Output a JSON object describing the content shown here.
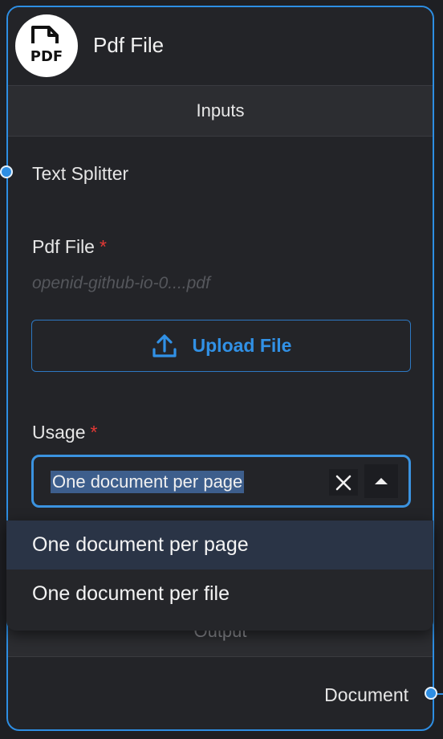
{
  "node": {
    "title": "Pdf File",
    "icon": "pdf-file-icon",
    "icon_text": "PDF",
    "accent_color": "#2d8ee3"
  },
  "inputs": {
    "section_label": "Inputs",
    "connection_label": "Text Splitter",
    "pdf_file": {
      "label": "Pdf File",
      "required_mark": "*",
      "filename": "openid-github-io-0....pdf",
      "upload_label": "Upload File",
      "upload_icon": "upload-icon"
    },
    "usage": {
      "label": "Usage",
      "required_mark": "*",
      "selected_value": "One document per page",
      "options": [
        "One document per page",
        "One document per file"
      ]
    }
  },
  "output": {
    "section_label": "Output",
    "connection_label": "Document"
  }
}
